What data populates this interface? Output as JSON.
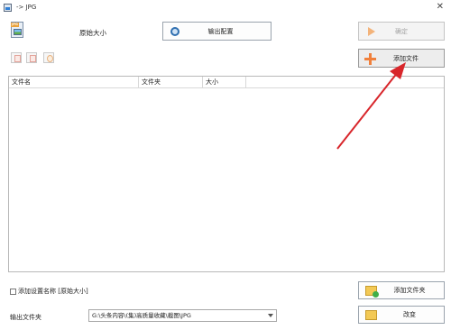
{
  "window": {
    "title": "-> JPG",
    "close_glyph": "✕"
  },
  "header": {
    "size_label": "原始大小",
    "output_config_label": "输出配置",
    "ok_label": "确定"
  },
  "toolbar": {
    "add_file_label": "添加文件"
  },
  "table": {
    "columns": [
      "文件名",
      "文件夹",
      "大小"
    ],
    "rows": []
  },
  "bottom": {
    "checkbox_label": "添加设置名称 [原始大小]",
    "checkbox_checked": false,
    "add_folder_label": "添加文件夹",
    "change_label": "改变",
    "output_folder_label": "输出文件夹",
    "output_folder_value": "G:\\头条内容\\(集)高质量收藏\\截图\\JPG"
  },
  "colors": {
    "annotation_arrow": "#d8262b",
    "plus_orange": "#f0803c"
  },
  "icons": [
    "app-icon",
    "jpg-format-icon",
    "gear-icon",
    "arrow-right-icon",
    "plus-icon",
    "folder-add-icon",
    "folder-icon",
    "chevron-down-icon"
  ]
}
